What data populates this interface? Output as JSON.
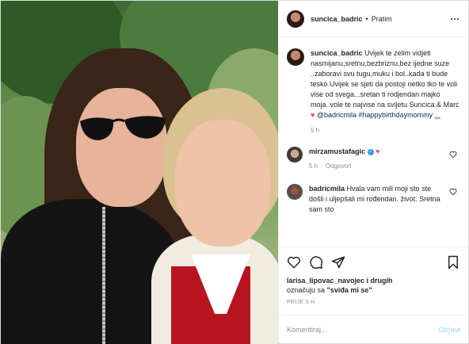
{
  "header": {
    "username": "suncica_badric",
    "separator": "•",
    "follow_label": "Pratim"
  },
  "caption": {
    "username": "suncica_badric",
    "text": "Uvijek te zelim vidjeti nasmijanu,sretnu,bezbriznu,bez ijedne suze ..zaboravi svu tugu,muku i bol..kada ti bude tesko Uvijek se sjeti da postoji netko tko te voli vise od svega...sretan ti rodjendan majko moja..vole te najvise na svijetu Suncica & Marc",
    "mention": "@badricmila",
    "hashtag": "#happybirthdaymommy",
    "time": "5 h"
  },
  "comments": [
    {
      "username": "mirzamustafagic",
      "text": "",
      "reply_label": "Odgovori",
      "time": "5 h"
    },
    {
      "username": "badricmila",
      "text": "Hvala vam mili moji sto ste došli i uljepšali mi rođendan. život. Sretna sam sto"
    }
  ],
  "likes": {
    "names": "larisa_lipovac_navojec i drugih",
    "label_prefix": "označuju sa",
    "label_quote": "\"sviđa mi se\""
  },
  "posted": "PRIJE 5 H",
  "comment_box": {
    "placeholder": "Komentiraj...",
    "post_label": "Objavi"
  },
  "colors": {
    "accent": "#3897f0",
    "heart": "#ed4956",
    "muted": "#8e8e8e",
    "post_disabled": "#b2dffc"
  },
  "icons": {
    "like": "heart-outline-icon",
    "comment": "speech-bubble-icon",
    "share": "paper-plane-icon",
    "save": "bookmark-icon",
    "more": "ellipsis-icon",
    "verified": "verified-badge-icon"
  }
}
